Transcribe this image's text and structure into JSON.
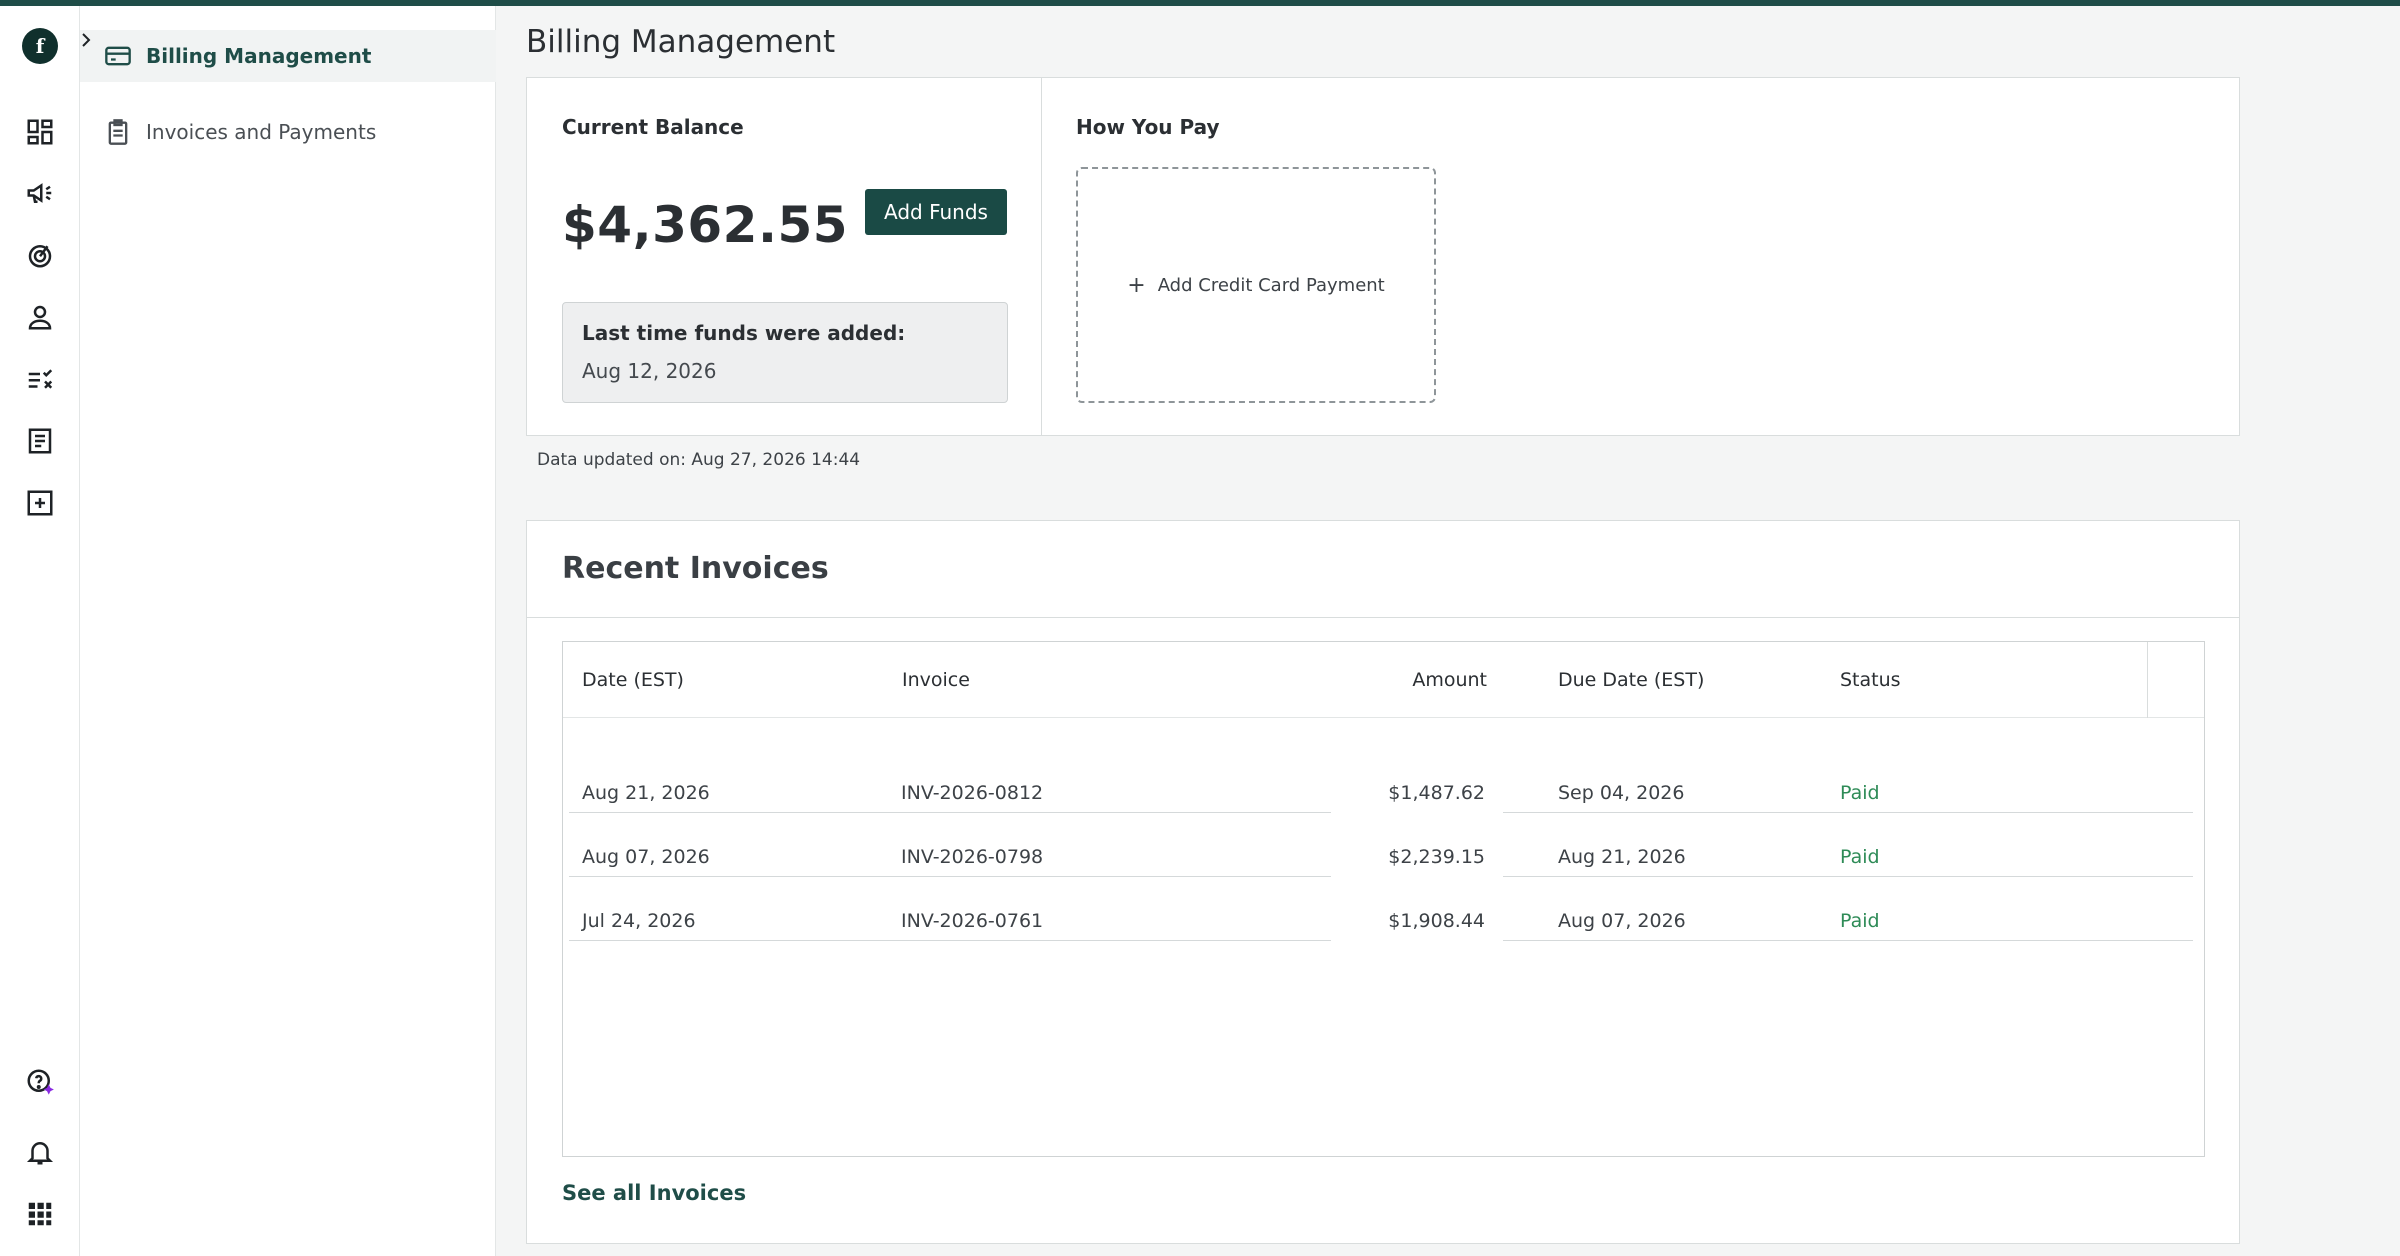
{
  "nav": {
    "logo_letter": "f",
    "rail_icons": [
      "dashboard-icon",
      "megaphone-icon",
      "target-icon",
      "person-icon",
      "tasks-icon",
      "document-icon",
      "add-report-icon",
      "help-ai-icon",
      "bell-icon",
      "apps-grid-icon"
    ],
    "subnav": [
      {
        "label": "Billing Management",
        "icon": "credit-card-icon",
        "active": true
      },
      {
        "label": "Invoices and Payments",
        "icon": "clipboard-icon",
        "active": false
      }
    ]
  },
  "page": {
    "title": "Billing Management"
  },
  "balance": {
    "heading": "Current Balance",
    "amount": "$4,362.55",
    "add_funds_label": "Add Funds",
    "last_funds_label": "Last time funds were added:",
    "last_funds_date": "Aug 12, 2026"
  },
  "payment": {
    "heading": "How You Pay",
    "add_card_label": "Add Credit Card Payment"
  },
  "data_updated": "Data updated on: Aug 27, 2026 14:44",
  "invoices": {
    "title": "Recent Invoices",
    "columns": [
      "Date (EST)",
      "Invoice",
      "Amount",
      "Due Date (EST)",
      "Status"
    ],
    "rows": [
      {
        "date": "Aug 21, 2026",
        "invoice": "INV-2026-0812",
        "amount": "$1,487.62",
        "due": "Sep 04, 2026",
        "status": "Paid"
      },
      {
        "date": "Aug 07, 2026",
        "invoice": "INV-2026-0798",
        "amount": "$2,239.15",
        "due": "Aug 21, 2026",
        "status": "Paid"
      },
      {
        "date": "Jul 24, 2026",
        "invoice": "INV-2026-0761",
        "amount": "$1,908.44",
        "due": "Aug 07, 2026",
        "status": "Paid"
      }
    ],
    "see_all_label": "See all Invoices"
  },
  "colors": {
    "brand": "#1f4d48",
    "paid": "#2e8b57",
    "ai_accent": "#8a2be2"
  }
}
